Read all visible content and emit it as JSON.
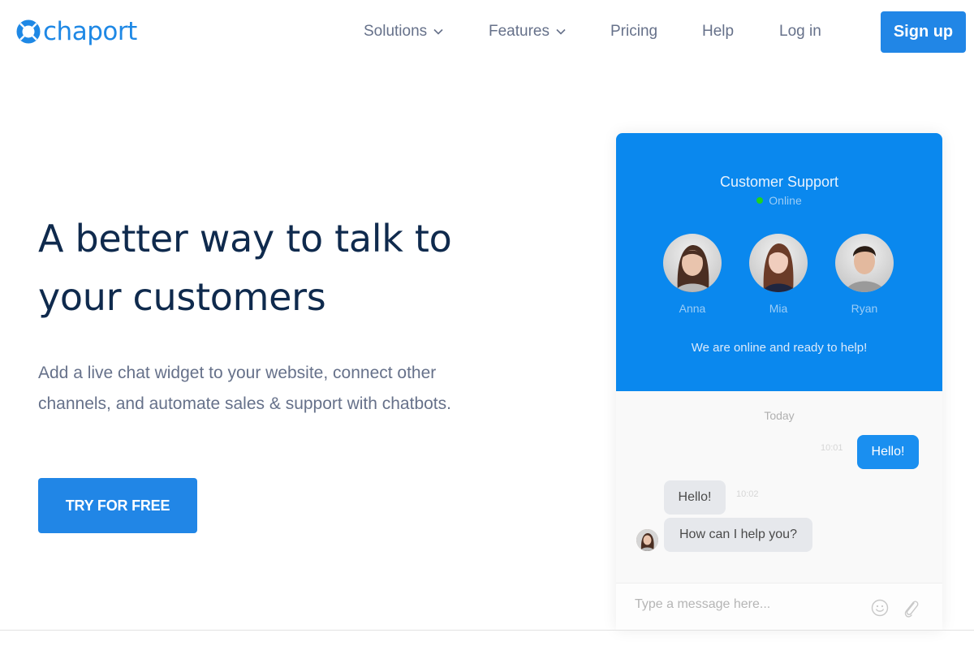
{
  "brand": {
    "name": "chaport",
    "color": "#1e88e5"
  },
  "nav": {
    "items": [
      {
        "label": "Solutions",
        "has_dropdown": true
      },
      {
        "label": "Features",
        "has_dropdown": true
      },
      {
        "label": "Pricing",
        "has_dropdown": false
      },
      {
        "label": "Help",
        "has_dropdown": false
      },
      {
        "label": "Log in",
        "has_dropdown": false
      }
    ],
    "signup_label": "Sign up"
  },
  "hero": {
    "title_line1": "A better way to talk to",
    "title_line2": "your customers",
    "subtitle": "Add a live chat widget to your website, connect other channels, and automate sales & support with chatbots.",
    "cta_label": "TRY FOR FREE"
  },
  "widget": {
    "title": "Customer Support",
    "status": "Online",
    "status_color": "#1fd21f",
    "agents": [
      {
        "name": "Anna"
      },
      {
        "name": "Mia"
      },
      {
        "name": "Ryan"
      }
    ],
    "tagline": "We are online and ready to help!",
    "day_label": "Today",
    "messages": [
      {
        "direction": "out",
        "text": "Hello!",
        "time": "10:01"
      },
      {
        "direction": "in",
        "text": "Hello!",
        "time": "10:02"
      },
      {
        "direction": "in",
        "text": "How can I help you?",
        "time": ""
      }
    ],
    "composer_placeholder": "Type a message here...",
    "icons": [
      "smiley-icon",
      "paperclip-icon"
    ]
  },
  "colors": {
    "primary": "#2186e6",
    "widget_header": "#0a88ee",
    "heading": "#0f2a4d",
    "body_text": "#66718a"
  }
}
